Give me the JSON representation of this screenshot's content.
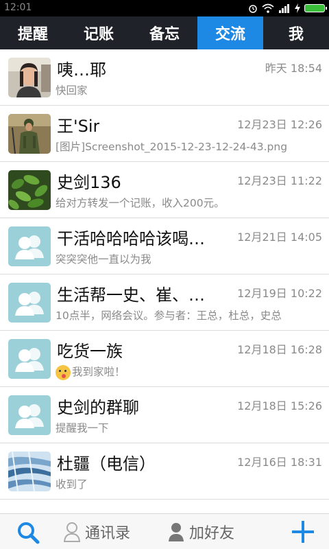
{
  "status_bar": {
    "time": "12:01",
    "icons": [
      "alarm-icon",
      "wifi-icon",
      "signal-icon",
      "charging-icon",
      "battery-icon"
    ]
  },
  "tabs": [
    {
      "label": "提醒",
      "active": false
    },
    {
      "label": "记账",
      "active": false
    },
    {
      "label": "备忘",
      "active": false
    },
    {
      "label": "交流",
      "active": true
    },
    {
      "label": "我",
      "active": false
    }
  ],
  "conversations": [
    {
      "name": "咦…耶",
      "time": "昨天 18:54",
      "preview": "快回家",
      "avatar": "photo-woman"
    },
    {
      "name": "王'Sir",
      "time": "12月23日 12:26",
      "preview": "[图片]Screenshot_2015-12-23-12-24-43.png",
      "avatar": "photo-soldier"
    },
    {
      "name": "史剑136",
      "time": "12月23日 11:22",
      "preview": "给对方转发一个记账，收入200元。",
      "avatar": "photo-plant"
    },
    {
      "name": "干活哈哈哈哈该喝…",
      "time": "12月21日 14:05",
      "preview": "突突突他一直以为我",
      "avatar": "group"
    },
    {
      "name": "生活帮一史、崔、…",
      "time": "12月19日 10:22",
      "preview": "10点半，网络会议。参与者：王总，杜总，史总",
      "avatar": "group"
    },
    {
      "name": "吃货一族",
      "time": "12月18日 16:28",
      "preview": "我到家啦！",
      "avatar": "group",
      "emoji": true
    },
    {
      "name": "史剑的群聊",
      "time": "12月18日 15:26",
      "preview": "提醒我一下",
      "avatar": "group"
    },
    {
      "name": "杜疆（电信）",
      "time": "12月16日 18:31",
      "preview": "收到了",
      "avatar": "photo-ice"
    }
  ],
  "bottom_bar": {
    "contacts_label": "通讯录",
    "add_friend_label": "加好友"
  },
  "colors": {
    "accent": "#1e88e5",
    "tab_bg": "#1f2228",
    "group_avatar": "#9bd0d8"
  }
}
